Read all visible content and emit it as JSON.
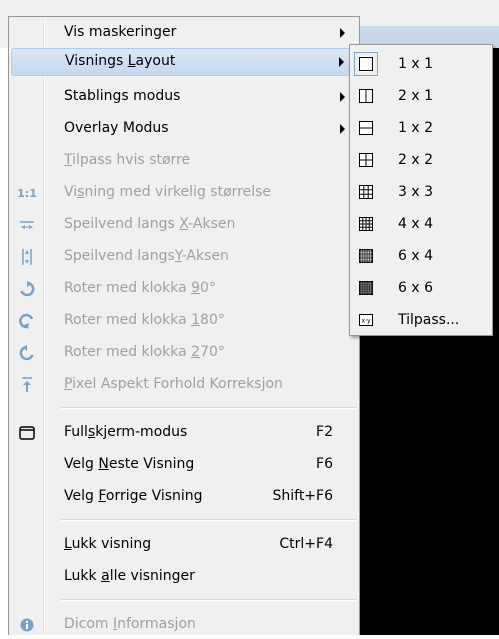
{
  "main_menu": {
    "items": [
      {
        "label": "Vis maskeringer",
        "shortcut": "",
        "submenu": true,
        "disabled": false,
        "icon": ""
      },
      {
        "label": "Visnings Layout",
        "shortcut": "",
        "submenu": true,
        "disabled": false,
        "icon": "",
        "highlighted": true
      },
      {
        "label": "Stablings modus",
        "shortcut": "",
        "submenu": true,
        "disabled": false,
        "icon": ""
      },
      {
        "label": "Overlay Modus",
        "shortcut": "",
        "submenu": true,
        "disabled": false,
        "icon": ""
      },
      {
        "label": "Tilpass hvis større",
        "shortcut": "",
        "submenu": false,
        "disabled": true,
        "icon": ""
      },
      {
        "label": "Visning med virkelig størrelse",
        "shortcut": "",
        "submenu": false,
        "disabled": true,
        "icon": "1:1"
      },
      {
        "label": "Speilvend langs X-Aksen",
        "shortcut": "",
        "submenu": false,
        "disabled": true,
        "icon": "flip-horizontal-icon"
      },
      {
        "label": "Speilvend langsY-Aksen",
        "shortcut": "",
        "submenu": false,
        "disabled": true,
        "icon": "flip-vertical-icon"
      },
      {
        "label": "Roter med klokka 90°",
        "shortcut": "",
        "submenu": false,
        "disabled": true,
        "icon": "rotate-90-icon"
      },
      {
        "label": "Roter med klokka 180°",
        "shortcut": "",
        "submenu": false,
        "disabled": true,
        "icon": "rotate-180-icon"
      },
      {
        "label": "Roter med klokka 270°",
        "shortcut": "",
        "submenu": false,
        "disabled": true,
        "icon": "rotate-270-icon"
      },
      {
        "label": "Pixel Aspekt Forhold Korreksjon",
        "shortcut": "",
        "submenu": false,
        "disabled": true,
        "icon": "pixel-aspect-icon"
      },
      {
        "label": "Fullskjerm-modus",
        "shortcut": "F2",
        "submenu": false,
        "disabled": false,
        "icon": "fullscreen-icon"
      },
      {
        "label": "Velg Neste Visning",
        "shortcut": "F6",
        "submenu": false,
        "disabled": false,
        "icon": ""
      },
      {
        "label": "Velg Forrige Visning",
        "shortcut": "Shift+F6",
        "submenu": false,
        "disabled": false,
        "icon": ""
      },
      {
        "label": "Lukk visning",
        "shortcut": "Ctrl+F4",
        "submenu": false,
        "disabled": false,
        "icon": ""
      },
      {
        "label": "Lukk alle visninger",
        "shortcut": "",
        "submenu": false,
        "disabled": false,
        "icon": ""
      },
      {
        "label": "Dicom Informasjon",
        "shortcut": "",
        "submenu": false,
        "disabled": true,
        "icon": "info-icon"
      }
    ]
  },
  "layout_submenu": {
    "items": [
      {
        "label": "1 x 1",
        "icon": "layout-1x1-icon",
        "checked": true
      },
      {
        "label": "2 x 1",
        "icon": "layout-2x1-icon",
        "checked": false
      },
      {
        "label": "1 x 2",
        "icon": "layout-1x2-icon",
        "checked": false
      },
      {
        "label": "2 x 2",
        "icon": "layout-2x2-icon",
        "checked": false
      },
      {
        "label": "3 x 3",
        "icon": "layout-3x3-icon",
        "checked": false
      },
      {
        "label": "4 x 4",
        "icon": "layout-4x4-icon",
        "checked": false
      },
      {
        "label": "6 x 4",
        "icon": "layout-6x4-icon",
        "checked": false
      },
      {
        "label": "6 x 6",
        "icon": "layout-6x6-icon",
        "checked": false
      },
      {
        "label": "Tilpass...",
        "icon": "layout-custom-icon",
        "checked": false
      }
    ]
  },
  "colors": {
    "menu_bg": "#f0f0f0",
    "highlight": "#c4d8ef",
    "disabled_text": "#a0a0a0",
    "icon_blue": "#7aa1c8"
  }
}
